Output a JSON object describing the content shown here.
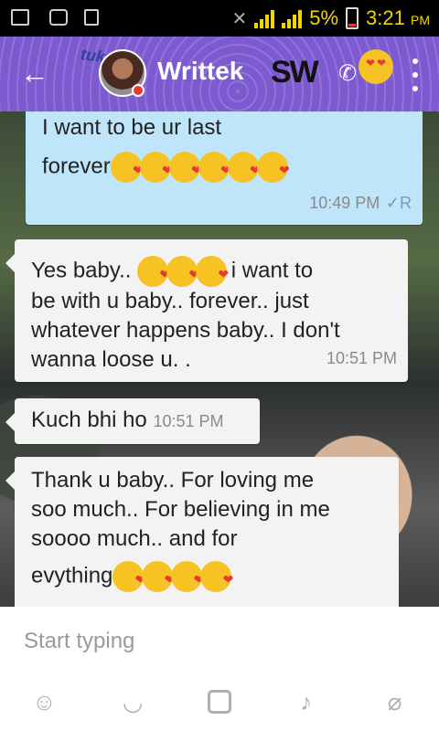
{
  "status_bar": {
    "battery": "5%",
    "time": "3:21",
    "ampm": "PM"
  },
  "header": {
    "contact_name": "Writtek",
    "decoration_left": "tukur",
    "decoration_right": "SW"
  },
  "messages": [
    {
      "direction": "outgoing",
      "lines": [
        "I want to be ur last",
        "forever"
      ],
      "emoji_count": 6,
      "time": "10:49 PM",
      "receipt": "✓R"
    },
    {
      "direction": "incoming",
      "lines": [
        "Yes baby..",
        "i want to",
        "be with u baby.. forever.. just",
        "whatever happens baby.. I don't",
        "wanna loose u. ."
      ],
      "emoji_count": 3,
      "time": "10:51 PM"
    },
    {
      "direction": "incoming",
      "lines": [
        "Kuch bhi ho"
      ],
      "time": "10:51 PM"
    },
    {
      "direction": "incoming",
      "lines": [
        "Thank u baby.. For loving me",
        "soo much.. For believing in me",
        "soooo much.. and for",
        "evything"
      ],
      "emoji_count": 4
    }
  ],
  "composer": {
    "placeholder": "Start typing"
  },
  "icons": {
    "back": "arrow-left-icon",
    "call": "phone-icon",
    "menu": "more-vertical-icon",
    "toolbar": [
      "smiley-icon",
      "sticker-icon",
      "camera-icon",
      "microphone-icon",
      "attachment-icon"
    ]
  },
  "colors": {
    "app_bar": "#7e5ad1",
    "outgoing_bubble": "#bfe5fb",
    "incoming_bubble": "#f3f3f3"
  }
}
